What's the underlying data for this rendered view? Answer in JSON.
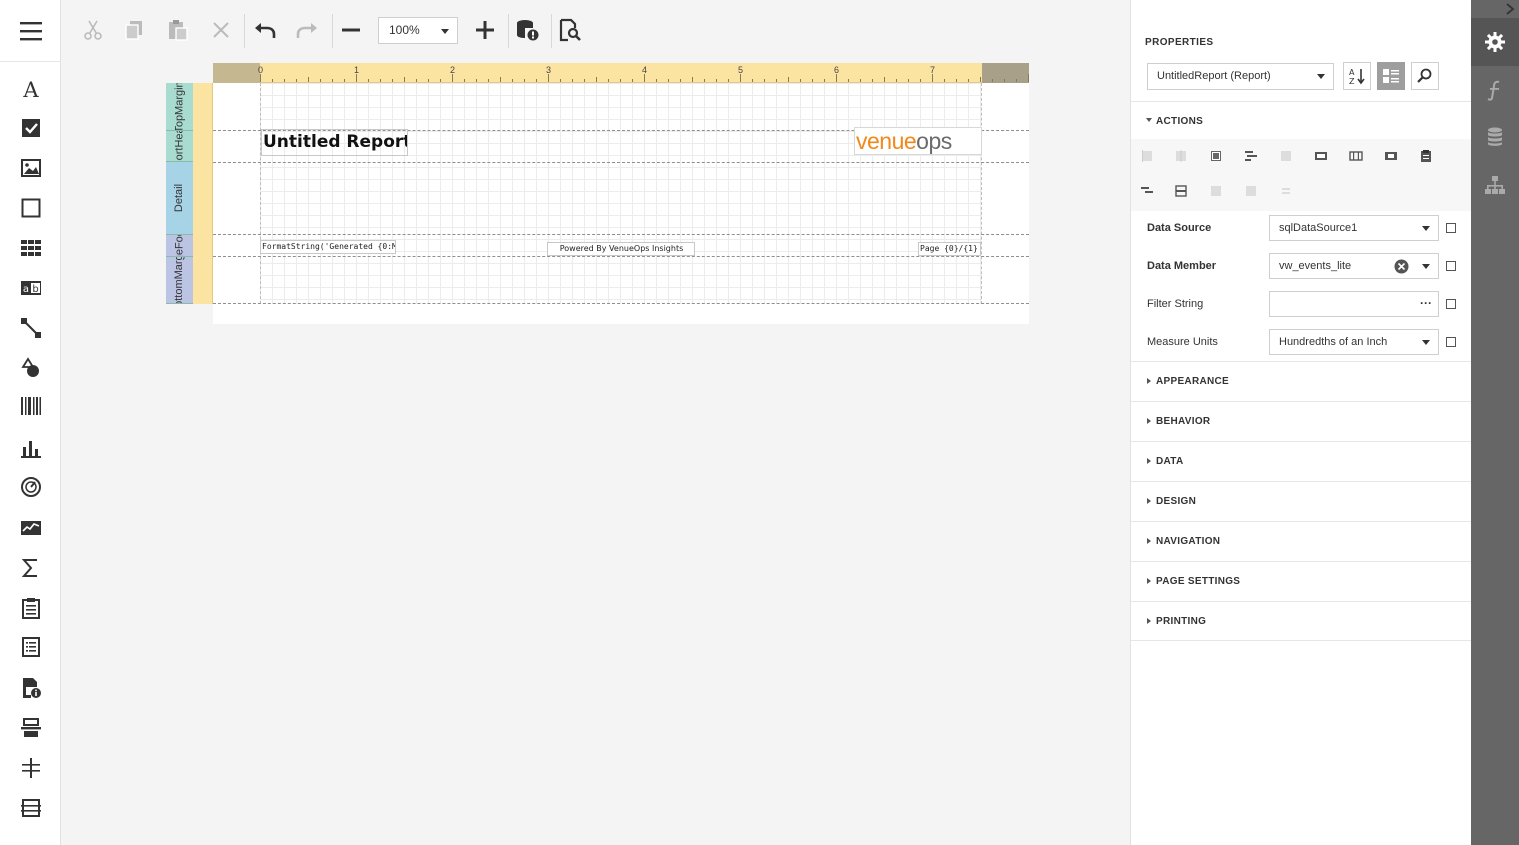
{
  "toolbar": {
    "zoom": "100%",
    "buttons": [
      "cut",
      "copy",
      "paste",
      "delete",
      "undo",
      "redo",
      "zoom-out",
      "zoom-in",
      "validate-bindings",
      "preview"
    ]
  },
  "toolbox": {
    "items": [
      "label",
      "check-box",
      "picture-box",
      "panel",
      "table",
      "character-comb",
      "line",
      "shape",
      "barcode",
      "chart",
      "gauge",
      "sparkline",
      "cross-tab",
      "subreport",
      "table-of-contents",
      "page-info",
      "page-break",
      "cross-band-line",
      "cross-band-box"
    ]
  },
  "report": {
    "bands": [
      "TopMargin",
      "ReportHeader",
      "Detail",
      "PageFooter",
      "BottomMargin"
    ],
    "ruler_ticks": [
      "0",
      "1",
      "2",
      "3",
      "4",
      "5",
      "6",
      "7"
    ],
    "title": "Untitled Report",
    "logo_part1": "venue",
    "logo_part2": "ops",
    "footer_generated": "FormatString('Generated {0:M",
    "footer_powered": "Powered By VenueOps Insights",
    "footer_page": "Page {0}/{1}"
  },
  "properties": {
    "title": "PROPERTIES",
    "object": "UntitledReport (Report)",
    "actions_label": "ACTIONS",
    "rows": [
      {
        "name": "Data Source",
        "value": "sqlDataSource1",
        "bold": true
      },
      {
        "name": "Data Member",
        "value": "vw_events_lite",
        "bold": true
      },
      {
        "name": "Filter String",
        "value": "",
        "bold": false
      },
      {
        "name": "Measure Units",
        "value": "Hundredths of an Inch",
        "bold": false
      }
    ],
    "sections": [
      "APPEARANCE",
      "BEHAVIOR",
      "DATA",
      "DESIGN",
      "NAVIGATION",
      "PAGE SETTINGS",
      "PRINTING"
    ]
  },
  "colors": {
    "ruler": "#fbe3a1",
    "logo_orange": "#f0891c",
    "sidebar_dark": "#666666"
  }
}
